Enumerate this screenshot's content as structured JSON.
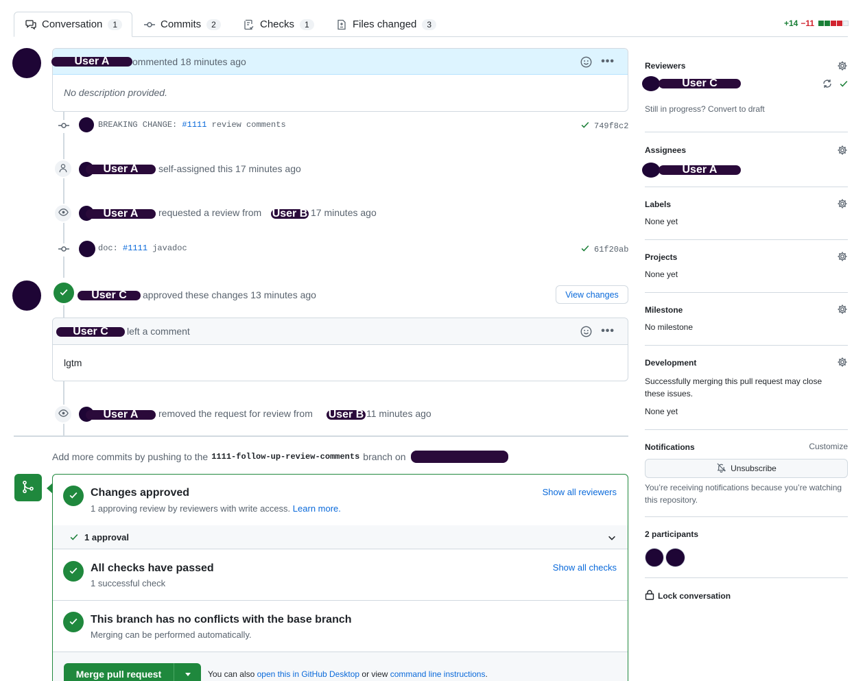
{
  "tabs": [
    {
      "label": "Conversation",
      "count": "1"
    },
    {
      "label": "Commits",
      "count": "2"
    },
    {
      "label": "Checks",
      "count": "1"
    },
    {
      "label": "Files changed",
      "count": "3"
    }
  ],
  "diffstat": {
    "added": "+14",
    "removed": "−11"
  },
  "users": {
    "a": "User A",
    "b": "User B",
    "c": "User C"
  },
  "comment1": {
    "action": "ommented 18 minutes ago",
    "body": "No description provided."
  },
  "commit1": {
    "prefix": "BREAKING CHANGE: ",
    "ref": "#1111",
    "rest": " review comments",
    "sha": "749f8c2"
  },
  "event_assign": {
    "text": "self-assigned this 17 minutes ago"
  },
  "event_request": {
    "text": "requested a review from",
    "time": "17 minutes ago"
  },
  "commit2": {
    "prefix": "doc: ",
    "ref": "#1111",
    "rest": " javadoc",
    "sha": "61f20ab"
  },
  "review": {
    "text": "approved these changes 13 minutes ago",
    "view_changes": "View changes"
  },
  "review_comment": {
    "action": "left a comment",
    "body": "lgtm"
  },
  "event_remove": {
    "text": "removed the request for review from",
    "time": "11 minutes ago"
  },
  "push_hint": {
    "prefix": "Add more commits by pushing to the",
    "branch": "1111-follow-up-review-comments",
    "suffix": "branch on"
  },
  "merge": {
    "approved_title": "Changes approved",
    "approved_desc": "1 approving review by reviewers with write access.",
    "learn_more": "Learn more.",
    "show_reviewers": "Show all reviewers",
    "approval_count": "1 approval",
    "checks_title": "All checks have passed",
    "checks_desc": "1 successful check",
    "show_checks": "Show all checks",
    "conflict_title": "This branch has no conflicts with the base branch",
    "conflict_desc": "Merging can be performed automatically.",
    "merge_button": "Merge pull request",
    "also_prefix": "You can also",
    "desktop_link": "open this in GitHub Desktop",
    "or_view": "or view",
    "cli_link": "command line instructions",
    "period": "."
  },
  "sidebar": {
    "reviewers": {
      "heading": "Reviewers",
      "draft": "Still in progress? Convert to draft"
    },
    "assignees": {
      "heading": "Assignees"
    },
    "labels": {
      "heading": "Labels",
      "value": "None yet"
    },
    "projects": {
      "heading": "Projects",
      "value": "None yet"
    },
    "milestone": {
      "heading": "Milestone",
      "value": "No milestone"
    },
    "development": {
      "heading": "Development",
      "desc": "Successfully merging this pull request may close these issues.",
      "value": "None yet"
    },
    "notifications": {
      "heading": "Notifications",
      "customize": "Customize",
      "button": "Unsubscribe",
      "desc": "You’re receiving notifications because you’re watching this repository."
    },
    "participants": {
      "heading": "2 participants"
    },
    "lock": "Lock conversation"
  },
  "colors": {
    "green": "#1f883d",
    "link": "#0969da",
    "redaction": "#2a0a3a",
    "added": "#1a7f37",
    "removed": "#d1242f"
  }
}
